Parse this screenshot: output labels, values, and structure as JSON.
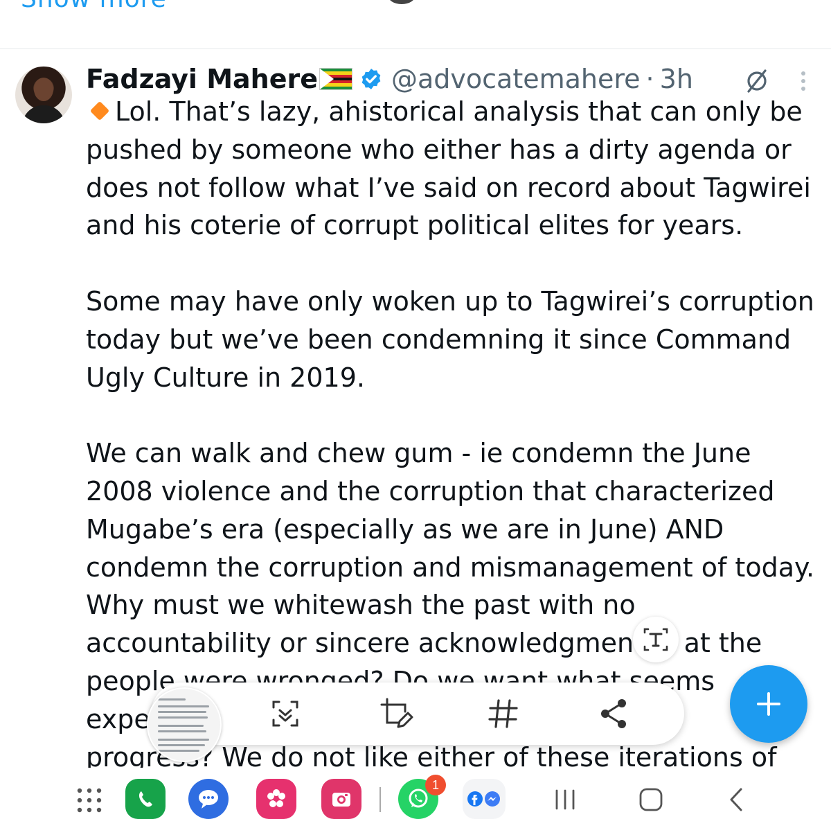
{
  "previous_tweet": {
    "show_more_label": "Show more"
  },
  "tweet": {
    "author_name": "Fadzayi Mahere",
    "handle": "@advocatemahere",
    "separator": "·",
    "time": "3h",
    "body": "Lol. That’s lazy, ahistorical analysis that can only be\npushed by someone who either has a dirty agenda or\ndoes not follow what I’ve said on record about Tagwirei\nand his coterie of corrupt political elites for years.\n\nSome may have only woken up to Tagwirei’s corruption\ntoday but we’ve been condemning it since Command\nUgly Culture in 2019.\n\nWe can walk and chew gum - ie condemn the June\n2008 violence and the corruption that characterized\nMugabe’s era (especially as we are in June) AND\ncondemn the corruption and mismanagement of today.\nWhy must we whitewash the past with no\naccountability or sincere acknowledgmen      at the\npeople were wronged? Do we want what seems\nexpe                                                    \nprogress? We do not like either of these iterations of"
  },
  "icons": {
    "verified": "verified-badge-icon",
    "grok": "grok-icon",
    "more": "more-vertical-icon",
    "flag": "zimbabwe-flag-icon",
    "diamond": "orange-diamond-emoji",
    "compose": "plus-icon",
    "text_extract": "text-extract-icon"
  },
  "screenshot_toolbar": {
    "actions": [
      "scroll-capture",
      "edit-crop",
      "tag",
      "share"
    ]
  },
  "system_nav": {
    "apps": [
      "app-drawer",
      "phone",
      "messages",
      "flower-app",
      "camera",
      "whatsapp",
      "facebook-messenger-folder"
    ],
    "whatsapp_badge": "1"
  },
  "colors": {
    "accent": "#1d9bf0",
    "text": "#0f1419",
    "secondary": "#536471"
  }
}
